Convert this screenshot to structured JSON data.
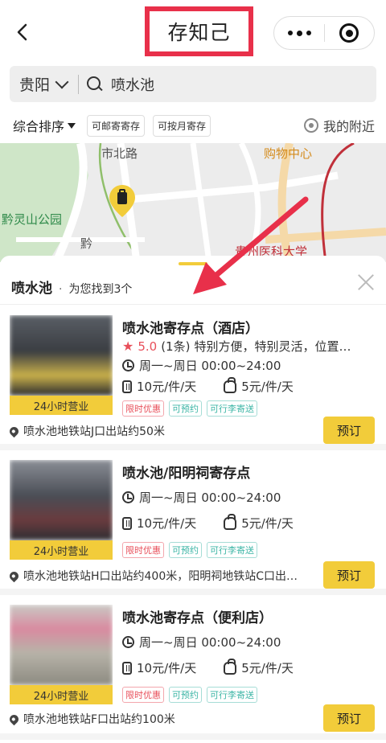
{
  "header": {
    "title": "存知己"
  },
  "search": {
    "city": "贵阳",
    "query": "喷水池"
  },
  "filters": {
    "sort": "综合排序",
    "tags": [
      "可邮寄寄存",
      "可按月寄存"
    ],
    "nearby": "我的附近"
  },
  "map": {
    "labels": [
      "市北路",
      "购物中心",
      "黔灵山公园",
      "黔",
      "贵州医科大学"
    ],
    "colors": {
      "park": "#cfe6c8",
      "road_main": "#ffffff",
      "road_highlight": "#f5d9a8",
      "route": "#c0303a"
    }
  },
  "panel": {
    "location": "喷水池",
    "dot": "·",
    "found_text": "为您找到3个"
  },
  "cards": [
    {
      "title": "喷水池寄存点（酒店）",
      "rating": {
        "score": "5.0",
        "count": "(1条)",
        "review": "特别方便，特别灵活，位置…"
      },
      "hours": "周一~周日 00:00~24:00",
      "price_case": "10元/件/天",
      "price_bag": "5元/件/天",
      "tags": [
        "限时优惠",
        "可预约",
        "可行李寄送"
      ],
      "badge": "24小时营业",
      "address": "喷水池地铁站J口出站约50米",
      "button": "预订"
    },
    {
      "title": "喷水池/阳明祠寄存点",
      "hours": "周一~周日 00:00~24:00",
      "price_case": "10元/件/天",
      "price_bag": "5元/件/天",
      "tags": [
        "限时优惠",
        "可预约",
        "可行李寄送"
      ],
      "badge": "24小时营业",
      "address": "喷水池地铁站H口出站约400米，阳明祠地铁站C口出…",
      "button": "预订"
    },
    {
      "title": "喷水池寄存点（便利店）",
      "hours": "周一~周日 00:00~24:00",
      "price_case": "10元/件/天",
      "price_bag": "5元/件/天",
      "tags": [
        "限时优惠",
        "可预约",
        "可行李寄送"
      ],
      "badge": "24小时营业",
      "address": "喷水池地铁站F口出站约100米",
      "button": "预订"
    }
  ],
  "theme": {
    "accent": "#f2cc3a",
    "highlight_red": "#e8304a",
    "rating_red": "#e8505b",
    "tag_teal": "#3bb5a5"
  }
}
